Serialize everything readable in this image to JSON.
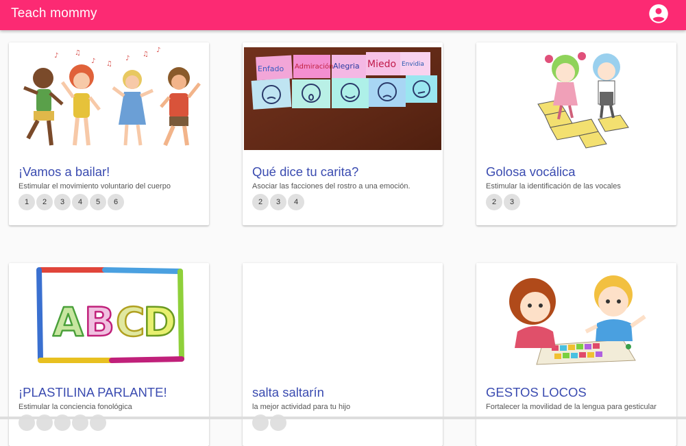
{
  "app": {
    "title": "Teach mommy",
    "account_icon": "account-circle-icon"
  },
  "cards": [
    {
      "title": "¡Vamos a bailar!",
      "subtitle": "Estimular el movimiento voluntario del cuerpo",
      "ages": [
        "1",
        "2",
        "3",
        "4",
        "5",
        "6"
      ]
    },
    {
      "title": "Qué dice tu carita?",
      "subtitle": "Asociar las facciones del rostro a una emoción.",
      "ages": [
        "2",
        "3",
        "4"
      ],
      "image_labels": [
        "Enfado",
        "Admiración",
        "Alegria",
        "Miedo",
        "Envidia"
      ]
    },
    {
      "title": "Golosa vocálica",
      "subtitle": "Estimular la identificación de las vocales",
      "ages": [
        "2",
        "3"
      ]
    },
    {
      "title": "¡PLASTILINA PARLANTE!",
      "subtitle": "Estimular la conciencia fonológica",
      "ages": [],
      "image_labels": [
        "A",
        "B",
        "C",
        "D"
      ]
    },
    {
      "title": "salta saltarín",
      "subtitle": "la mejor actividad para tu hijo",
      "ages": []
    },
    {
      "title": "GESTOS LOCOS",
      "subtitle": "Fortalecer la movilidad de la lengua para gesticular",
      "ages": []
    }
  ],
  "colors": {
    "toolbar": "#fc2a73",
    "card_title": "#3a4bb0"
  }
}
